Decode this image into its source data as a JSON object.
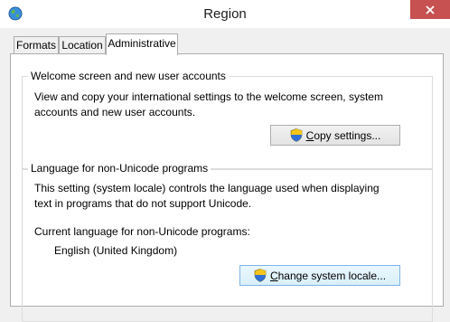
{
  "window": {
    "title": "Region"
  },
  "tabs": [
    {
      "label": "Formats"
    },
    {
      "label": "Location"
    },
    {
      "label": "Administrative"
    }
  ],
  "welcome_group": {
    "title": "Welcome screen and new user accounts",
    "description_line1": "View and copy your international settings to the welcome screen, system",
    "description_line2": "accounts and new user accounts.",
    "button_mnemonic": "C",
    "button_rest": "opy settings..."
  },
  "language_group": {
    "title": "Language for non-Unicode programs",
    "description_line1": "This setting (system locale) controls the language used when displaying",
    "description_line2": "text in programs that do not support Unicode.",
    "current_label": "Current language for non-Unicode programs:",
    "current_value": "English (United Kingdom)",
    "button_mnemonic": "C",
    "button_rest": "hange system locale..."
  },
  "colors": {
    "close_button": "#c75050",
    "window_bg": "#f0f0f0",
    "panel_bg": "#ffffff"
  },
  "icons": [
    "globe-icon",
    "close-icon",
    "uac-shield-icon"
  ]
}
